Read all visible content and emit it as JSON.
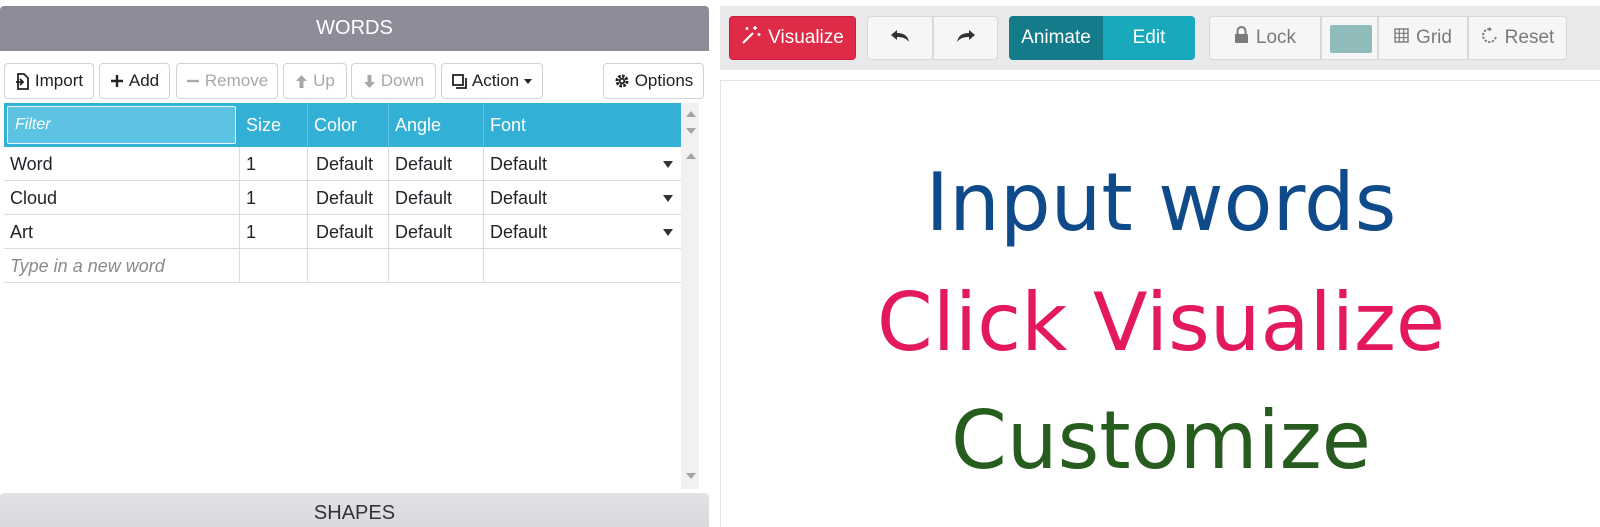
{
  "left_panel": {
    "words_title": "WORDS",
    "shapes_title": "SHAPES",
    "toolbar": {
      "import": "Import",
      "add": "Add",
      "remove": "Remove",
      "up": "Up",
      "down": "Down",
      "action": "Action",
      "options": "Options"
    },
    "table": {
      "filter_placeholder": "Filter",
      "columns": [
        "Size",
        "Color",
        "Angle",
        "Font"
      ],
      "rows": [
        {
          "word": "Word",
          "size": "1",
          "color": "Default",
          "angle": "Default",
          "font": "Default"
        },
        {
          "word": "Cloud",
          "size": "1",
          "color": "Default",
          "angle": "Default",
          "font": "Default"
        },
        {
          "word": "Art",
          "size": "1",
          "color": "Default",
          "angle": "Default",
          "font": "Default"
        }
      ],
      "new_word_placeholder": "Type in a new word"
    }
  },
  "right_toolbar": {
    "visualize": "Visualize",
    "animate": "Animate",
    "edit": "Edit",
    "lock": "Lock",
    "grid": "Grid",
    "reset": "Reset",
    "swatch_color": "#8fbcbb",
    "icons": [
      "magic-wand-icon",
      "undo-icon",
      "redo-icon",
      "lock-icon",
      "grid-icon",
      "reset-icon"
    ]
  },
  "canvas": {
    "lines": [
      {
        "text": "Input words",
        "color": "#0f4a8a"
      },
      {
        "text": "Click Visualize",
        "color": "#e3195c"
      },
      {
        "text": "Customize",
        "color": "#265c1e"
      }
    ]
  },
  "colors": {
    "header": "#8f8c99",
    "table_header": "#33b0d6",
    "visualize": "#e02b48",
    "animate": "#147b8a",
    "edit": "#18a9bc"
  }
}
